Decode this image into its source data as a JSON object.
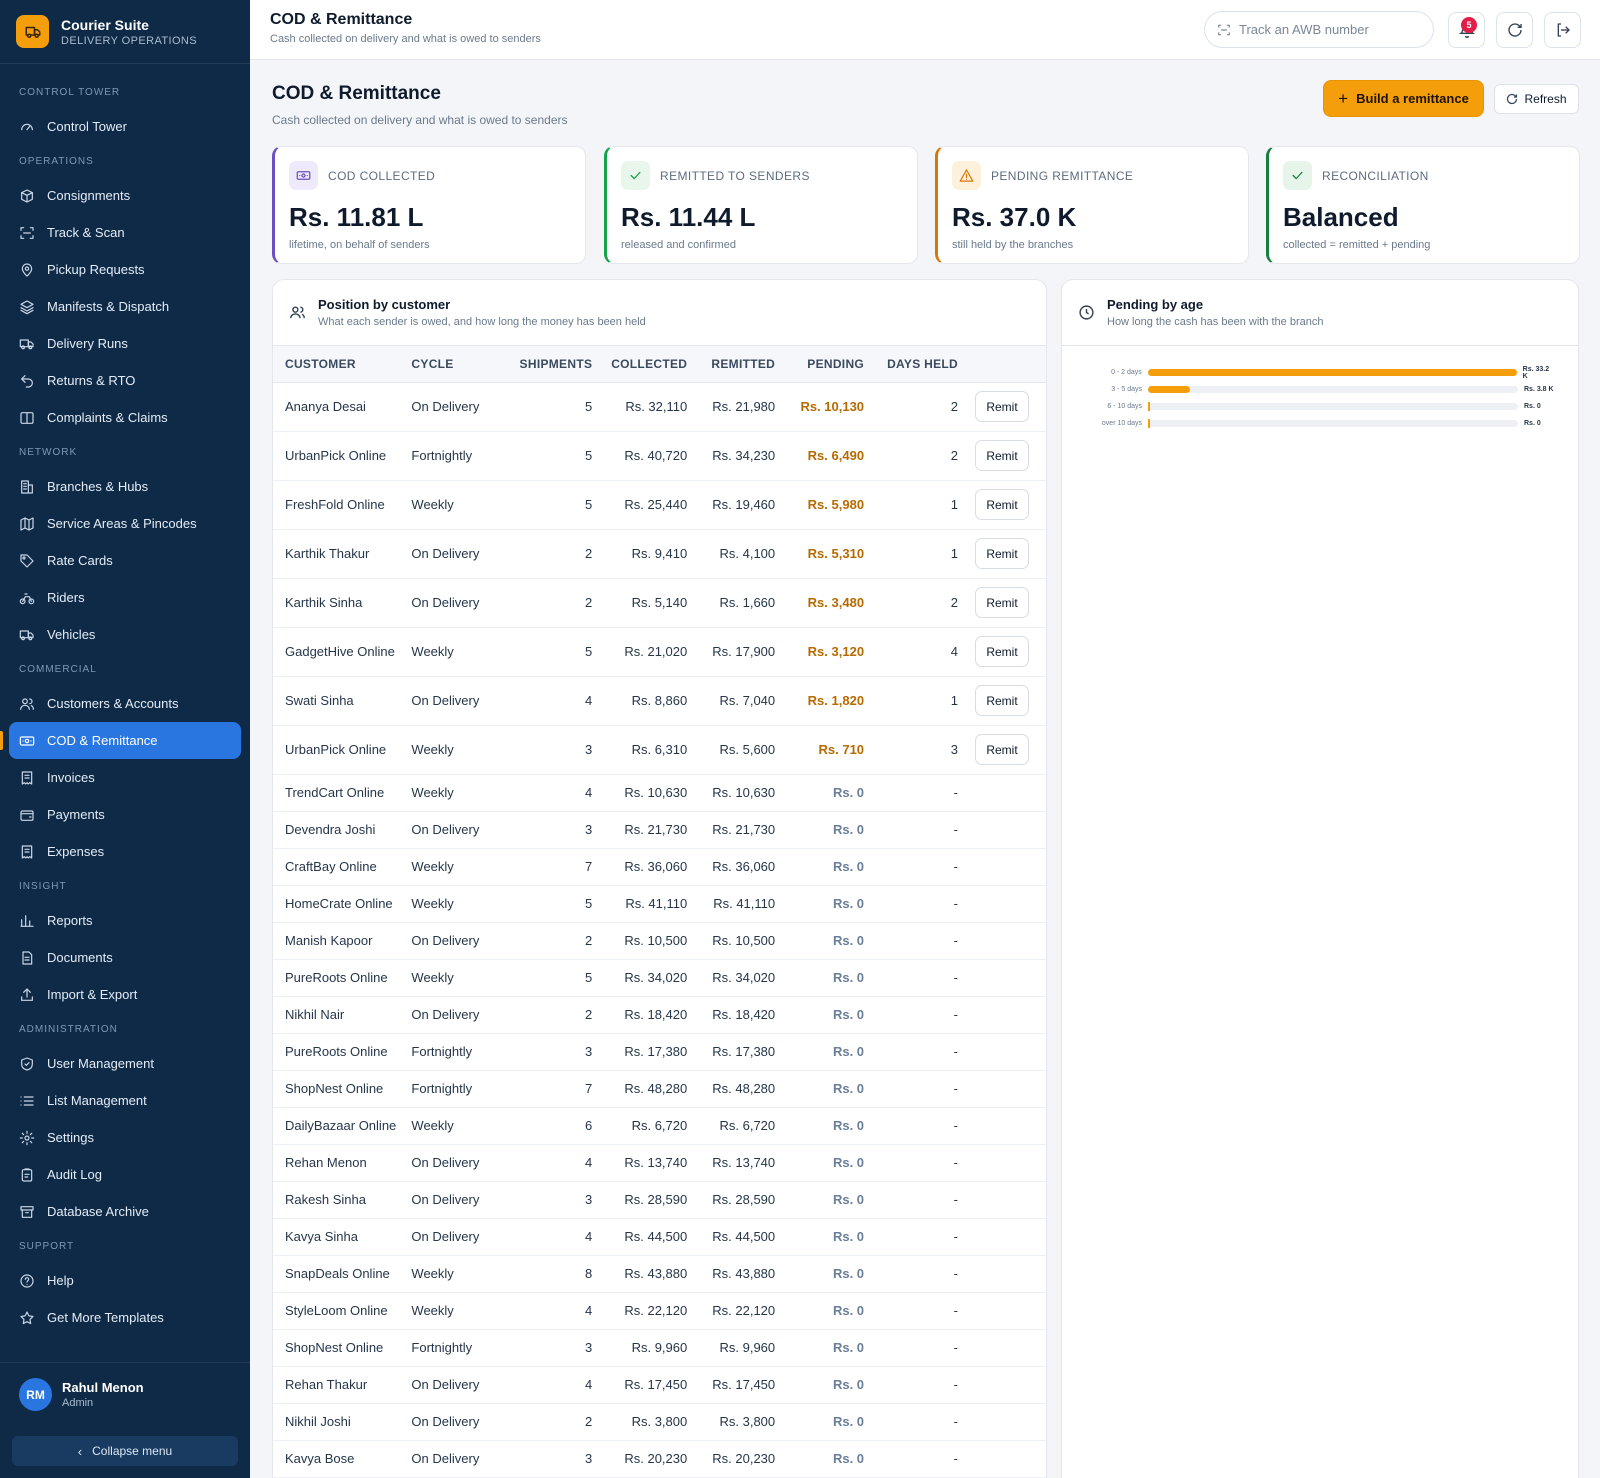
{
  "brand": {
    "name": "Courier Suite",
    "subtitle": "DELIVERY OPERATIONS"
  },
  "sidebar": {
    "sections": [
      {
        "label": "CONTROL TOWER",
        "items": [
          {
            "label": "Control Tower",
            "icon": "gauge-icon"
          }
        ]
      },
      {
        "label": "OPERATIONS",
        "items": [
          {
            "label": "Consignments",
            "icon": "boxes-icon"
          },
          {
            "label": "Track & Scan",
            "icon": "scan-icon"
          },
          {
            "label": "Pickup Requests",
            "icon": "map-pin-icon"
          },
          {
            "label": "Manifests & Dispatch",
            "icon": "layers-icon"
          },
          {
            "label": "Delivery Runs",
            "icon": "truck-icon"
          },
          {
            "label": "Returns & RTO",
            "icon": "undo-icon"
          },
          {
            "label": "Complaints & Claims",
            "icon": "columns-icon"
          }
        ]
      },
      {
        "label": "NETWORK",
        "items": [
          {
            "label": "Branches & Hubs",
            "icon": "building-icon"
          },
          {
            "label": "Service Areas & Pincodes",
            "icon": "map-icon"
          },
          {
            "label": "Rate Cards",
            "icon": "tag-icon"
          },
          {
            "label": "Riders",
            "icon": "bike-icon"
          },
          {
            "label": "Vehicles",
            "icon": "truck-icon"
          }
        ]
      },
      {
        "label": "COMMERCIAL",
        "items": [
          {
            "label": "Customers & Accounts",
            "icon": "users-icon"
          },
          {
            "label": "COD & Remittance",
            "icon": "banknote-icon",
            "active": true
          },
          {
            "label": "Invoices",
            "icon": "receipt-icon"
          },
          {
            "label": "Payments",
            "icon": "wallet-icon"
          },
          {
            "label": "Expenses",
            "icon": "receipt-icon"
          }
        ]
      },
      {
        "label": "INSIGHT",
        "items": [
          {
            "label": "Reports",
            "icon": "bar-chart-icon"
          },
          {
            "label": "Documents",
            "icon": "file-icon"
          },
          {
            "label": "Import & Export",
            "icon": "upload-icon"
          }
        ]
      },
      {
        "label": "ADMINISTRATION",
        "items": [
          {
            "label": "User Management",
            "icon": "shield-icon"
          },
          {
            "label": "List Management",
            "icon": "list-icon"
          },
          {
            "label": "Settings",
            "icon": "gear-icon"
          },
          {
            "label": "Audit Log",
            "icon": "clipboard-icon"
          },
          {
            "label": "Database Archive",
            "icon": "archive-icon"
          }
        ]
      },
      {
        "label": "SUPPORT",
        "items": [
          {
            "label": "Help",
            "icon": "help-icon"
          },
          {
            "label": "Get More Templates",
            "icon": "star-icon"
          }
        ]
      }
    ]
  },
  "user": {
    "initials": "RM",
    "name": "Rahul Menon",
    "role": "Admin"
  },
  "collapse_label": "Collapse menu",
  "topbar": {
    "title": "COD & Remittance",
    "subtitle": "Cash collected on delivery and what is owed to senders",
    "search_placeholder": "Track an AWB number",
    "notification_count": "5"
  },
  "page": {
    "title": "COD & Remittance",
    "subtitle": "Cash collected on delivery and what is owed to senders",
    "primary_action": "Build a remittance",
    "secondary_action": "Refresh"
  },
  "kpis": [
    {
      "label": "COD COLLECTED",
      "value": "Rs. 11.81 L",
      "note": "lifetime, on behalf of senders",
      "accent": "#6d4fc2",
      "icon": "banknote-icon"
    },
    {
      "label": "REMITTED TO SENDERS",
      "value": "Rs. 11.44 L",
      "note": "released and confirmed",
      "accent": "#16a34a",
      "icon": "check-icon"
    },
    {
      "label": "PENDING REMITTANCE",
      "value": "Rs. 37.0 K",
      "note": "still held by the branches",
      "accent": "#d97706",
      "icon": "warning-icon"
    },
    {
      "label": "RECONCILIATION",
      "value": "Balanced",
      "note": "collected = remitted + pending",
      "accent": "#15803d",
      "icon": "check-icon"
    }
  ],
  "position_panel": {
    "title": "Position by customer",
    "subtitle": "What each sender is owed, and how long the money has been held",
    "columns": [
      "CUSTOMER",
      "CYCLE",
      "SHIPMENTS",
      "COLLECTED",
      "REMITTED",
      "PENDING",
      "DAYS HELD"
    ],
    "remit_label": "Remit",
    "rows": [
      [
        "Ananya Desai",
        "On Delivery",
        "5",
        "Rs. 32,110",
        "Rs. 21,980",
        "Rs. 10,130",
        "2"
      ],
      [
        "UrbanPick Online",
        "Fortnightly",
        "5",
        "Rs. 40,720",
        "Rs. 34,230",
        "Rs. 6,490",
        "2"
      ],
      [
        "FreshFold Online",
        "Weekly",
        "5",
        "Rs. 25,440",
        "Rs. 19,460",
        "Rs. 5,980",
        "1"
      ],
      [
        "Karthik Thakur",
        "On Delivery",
        "2",
        "Rs. 9,410",
        "Rs. 4,100",
        "Rs. 5,310",
        "1"
      ],
      [
        "Karthik Sinha",
        "On Delivery",
        "2",
        "Rs. 5,140",
        "Rs. 1,660",
        "Rs. 3,480",
        "2"
      ],
      [
        "GadgetHive Online",
        "Weekly",
        "5",
        "Rs. 21,020",
        "Rs. 17,900",
        "Rs. 3,120",
        "4"
      ],
      [
        "Swati Sinha",
        "On Delivery",
        "4",
        "Rs. 8,860",
        "Rs. 7,040",
        "Rs. 1,820",
        "1"
      ],
      [
        "UrbanPick Online",
        "Weekly",
        "3",
        "Rs. 6,310",
        "Rs. 5,600",
        "Rs. 710",
        "3"
      ],
      [
        "TrendCart Online",
        "Weekly",
        "4",
        "Rs. 10,630",
        "Rs. 10,630",
        "Rs. 0",
        "-"
      ],
      [
        "Devendra Joshi",
        "On Delivery",
        "3",
        "Rs. 21,730",
        "Rs. 21,730",
        "Rs. 0",
        "-"
      ],
      [
        "CraftBay Online",
        "Weekly",
        "7",
        "Rs. 36,060",
        "Rs. 36,060",
        "Rs. 0",
        "-"
      ],
      [
        "HomeCrate Online",
        "Weekly",
        "5",
        "Rs. 41,110",
        "Rs. 41,110",
        "Rs. 0",
        "-"
      ],
      [
        "Manish Kapoor",
        "On Delivery",
        "2",
        "Rs. 10,500",
        "Rs. 10,500",
        "Rs. 0",
        "-"
      ],
      [
        "PureRoots Online",
        "Weekly",
        "5",
        "Rs. 34,020",
        "Rs. 34,020",
        "Rs. 0",
        "-"
      ],
      [
        "Nikhil Nair",
        "On Delivery",
        "2",
        "Rs. 18,420",
        "Rs. 18,420",
        "Rs. 0",
        "-"
      ],
      [
        "PureRoots Online",
        "Fortnightly",
        "3",
        "Rs. 17,380",
        "Rs. 17,380",
        "Rs. 0",
        "-"
      ],
      [
        "ShopNest Online",
        "Fortnightly",
        "7",
        "Rs. 48,280",
        "Rs. 48,280",
        "Rs. 0",
        "-"
      ],
      [
        "DailyBazaar Online",
        "Weekly",
        "6",
        "Rs. 6,720",
        "Rs. 6,720",
        "Rs. 0",
        "-"
      ],
      [
        "Rehan Menon",
        "On Delivery",
        "4",
        "Rs. 13,740",
        "Rs. 13,740",
        "Rs. 0",
        "-"
      ],
      [
        "Rakesh Sinha",
        "On Delivery",
        "3",
        "Rs. 28,590",
        "Rs. 28,590",
        "Rs. 0",
        "-"
      ],
      [
        "Kavya Sinha",
        "On Delivery",
        "4",
        "Rs. 44,500",
        "Rs. 44,500",
        "Rs. 0",
        "-"
      ],
      [
        "SnapDeals Online",
        "Weekly",
        "8",
        "Rs. 43,880",
        "Rs. 43,880",
        "Rs. 0",
        "-"
      ],
      [
        "StyleLoom Online",
        "Weekly",
        "4",
        "Rs. 22,120",
        "Rs. 22,120",
        "Rs. 0",
        "-"
      ],
      [
        "ShopNest Online",
        "Fortnightly",
        "3",
        "Rs. 9,960",
        "Rs. 9,960",
        "Rs. 0",
        "-"
      ],
      [
        "Rehan Thakur",
        "On Delivery",
        "4",
        "Rs. 17,450",
        "Rs. 17,450",
        "Rs. 0",
        "-"
      ],
      [
        "Nikhil Joshi",
        "On Delivery",
        "2",
        "Rs. 3,800",
        "Rs. 3,800",
        "Rs. 0",
        "-"
      ],
      [
        "Kavya Bose",
        "On Delivery",
        "3",
        "Rs. 20,230",
        "Rs. 20,230",
        "Rs. 0",
        "-"
      ]
    ]
  },
  "age_panel": {
    "title": "Pending by age",
    "subtitle": "How long the cash has been with the branch"
  },
  "chart_data": {
    "type": "bar",
    "orientation": "horizontal",
    "categories": [
      "0 - 2 days",
      "3 - 5 days",
      "6 - 10 days",
      "over 10 days"
    ],
    "values": [
      33200,
      3800,
      0,
      0
    ],
    "value_labels": [
      "Rs. 33.2 K",
      "Rs. 3.8 K",
      "Rs. 0",
      "Rs. 0"
    ],
    "bar_color": "#f59e0b",
    "grid": false
  }
}
